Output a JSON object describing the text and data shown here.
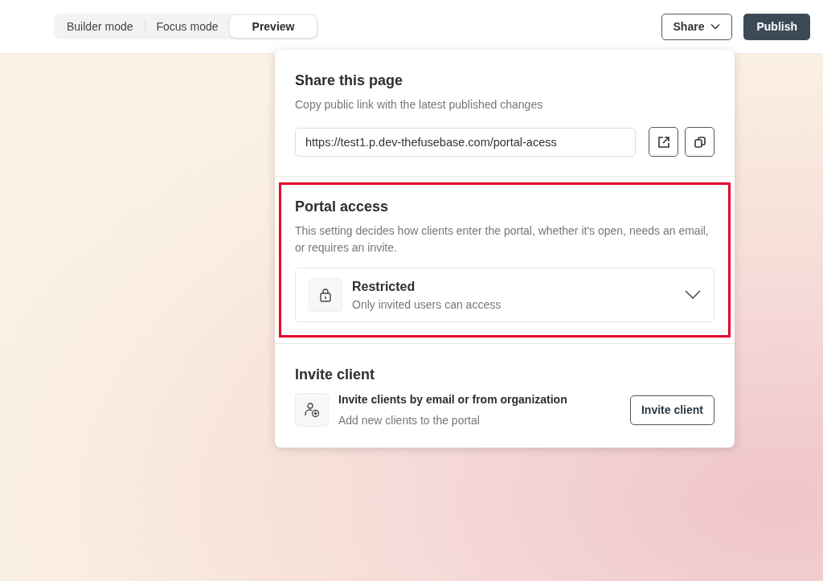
{
  "modes": [
    {
      "label": "Builder mode",
      "selected": false
    },
    {
      "label": "Focus mode",
      "selected": false
    },
    {
      "label": "Preview",
      "selected": true
    }
  ],
  "share_button": {
    "label": "Share"
  },
  "publish_button": {
    "label": "Publish"
  },
  "share_panel": {
    "title": "Share this page",
    "description": "Copy public link with the latest published changes",
    "link": "https://test1.p.dev-thefusebase.com/portal-acess"
  },
  "portal_access": {
    "title": "Portal access",
    "highlighted": true,
    "description": "This setting decides how clients enter the portal, whether it's open, needs an email, or requires an invite.",
    "option": {
      "title": "Restricted",
      "subtitle": "Only invited users can access"
    }
  },
  "invite": {
    "title": "Invite client",
    "heading": "Invite clients by email or from organization",
    "subtitle": "Add new clients to the portal",
    "button": "Invite client"
  }
}
